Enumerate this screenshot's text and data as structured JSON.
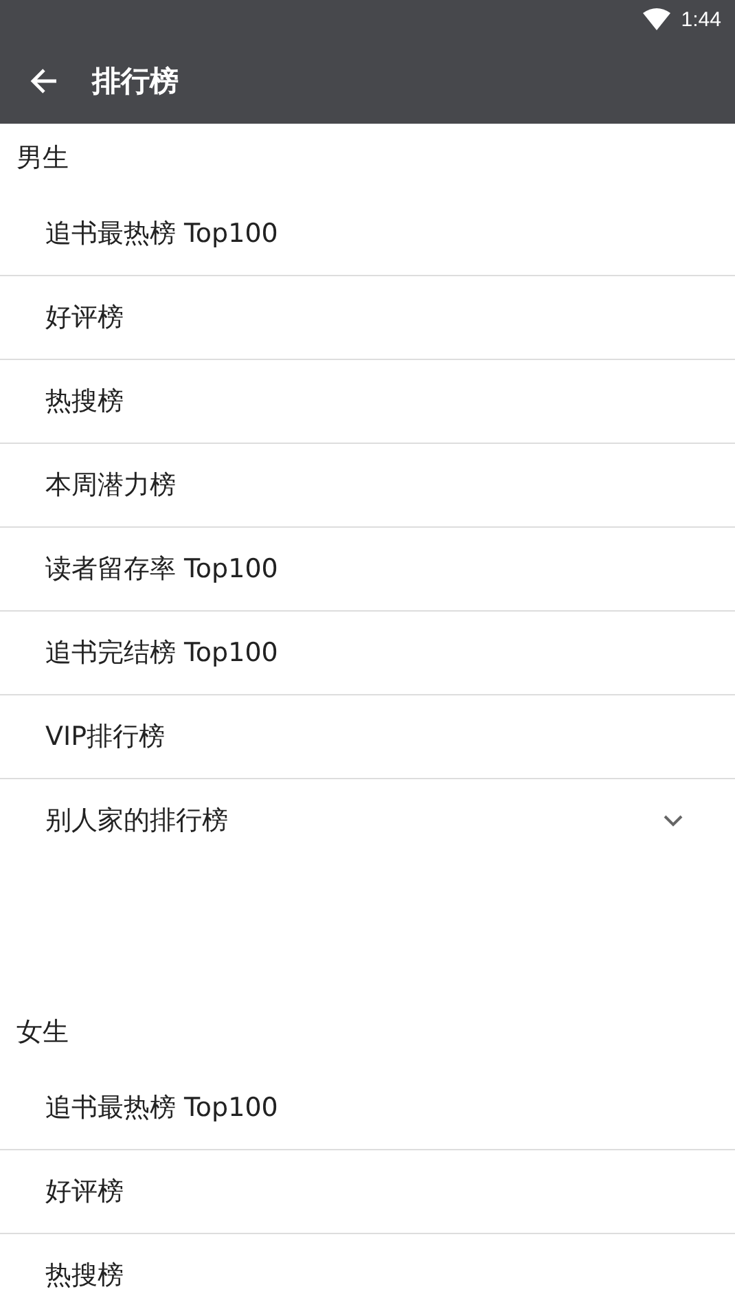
{
  "status_bar": {
    "time": "1:44"
  },
  "toolbar": {
    "title": "排行榜"
  },
  "sections": [
    {
      "header": "男生",
      "items": [
        {
          "label": "追书最热榜 Top100",
          "kind": "link"
        },
        {
          "label": "好评榜",
          "kind": "link"
        },
        {
          "label": "热搜榜",
          "kind": "link"
        },
        {
          "label": "本周潜力榜",
          "kind": "link"
        },
        {
          "label": "读者留存率 Top100",
          "kind": "link"
        },
        {
          "label": "追书完结榜 Top100",
          "kind": "link"
        },
        {
          "label": "VIP排行榜",
          "kind": "link"
        },
        {
          "label": "别人家的排行榜",
          "kind": "expandable",
          "expanded": false
        }
      ]
    },
    {
      "header": "女生",
      "items": [
        {
          "label": "追书最热榜 Top100",
          "kind": "link"
        },
        {
          "label": "好评榜",
          "kind": "link"
        },
        {
          "label": "热搜榜",
          "kind": "link"
        }
      ]
    }
  ]
}
